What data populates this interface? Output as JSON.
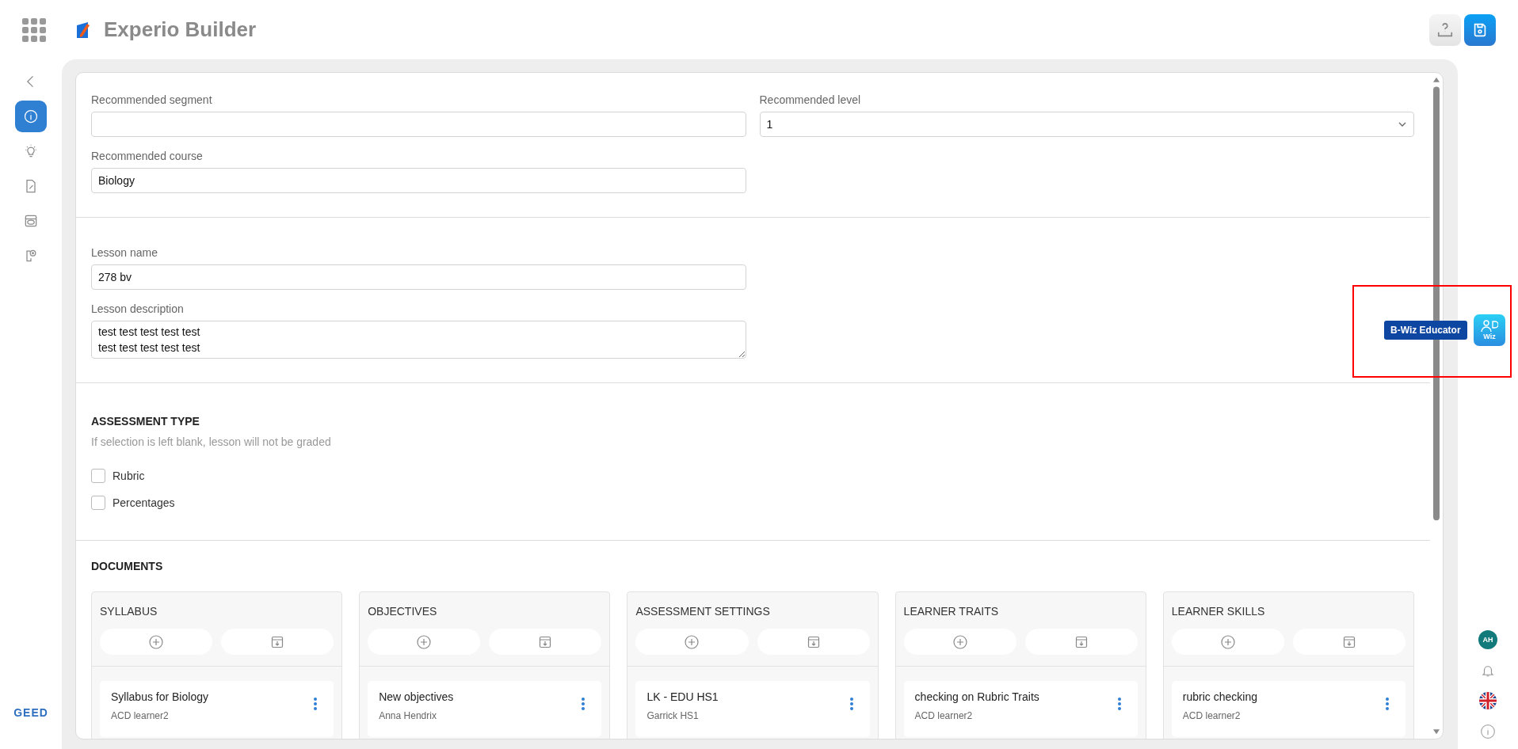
{
  "app": {
    "title": "Experio Builder",
    "brand": "GEED"
  },
  "nav": [
    {
      "kind": "back",
      "selected": false
    },
    {
      "kind": "info",
      "selected": true
    },
    {
      "kind": "bulb",
      "selected": false
    },
    {
      "kind": "document",
      "selected": false
    },
    {
      "kind": "gallery",
      "selected": false
    },
    {
      "kind": "device",
      "selected": false
    }
  ],
  "form": {
    "segment": {
      "label": "Recommended segment"
    },
    "level": {
      "label": "Recommended level",
      "value": "1"
    },
    "course": {
      "label": "Recommended course",
      "value": "Biology"
    },
    "lesson_name": {
      "label": "Lesson name",
      "value": "278 bv"
    },
    "lesson_description": {
      "label": "Lesson description",
      "value": "test test test test test\ntest test test test test"
    }
  },
  "assessment": {
    "title": "ASSESSMENT TYPE",
    "hint": "If selection is left blank, lesson will not be graded",
    "options": [
      {
        "label": "Rubric",
        "checked": false
      },
      {
        "label": "Percentages",
        "checked": false
      }
    ]
  },
  "documents": {
    "title": "DOCUMENTS",
    "columns": [
      {
        "title": "SYLLABUS",
        "items": [
          {
            "title": "Syllabus for Biology",
            "author": "ACD learner2"
          }
        ]
      },
      {
        "title": "OBJECTIVES",
        "items": [
          {
            "title": "New objectives",
            "author": "Anna Hendrix"
          }
        ]
      },
      {
        "title": "ASSESSMENT SETTINGS",
        "items": [
          {
            "title": "LK - EDU HS1",
            "author": "Garrick HS1"
          }
        ]
      },
      {
        "title": "LEARNER TRAITS",
        "items": [
          {
            "title": "checking on Rubric Traits",
            "author": "ACD learner2"
          }
        ]
      },
      {
        "title": "LEARNER SKILLS",
        "items": [
          {
            "title": "rubric checking",
            "author": "ACD learner2"
          }
        ]
      }
    ]
  },
  "assistant": {
    "label": "B-Wiz Educator",
    "icon_text": "Wiz"
  },
  "user": {
    "initials": "AH"
  }
}
